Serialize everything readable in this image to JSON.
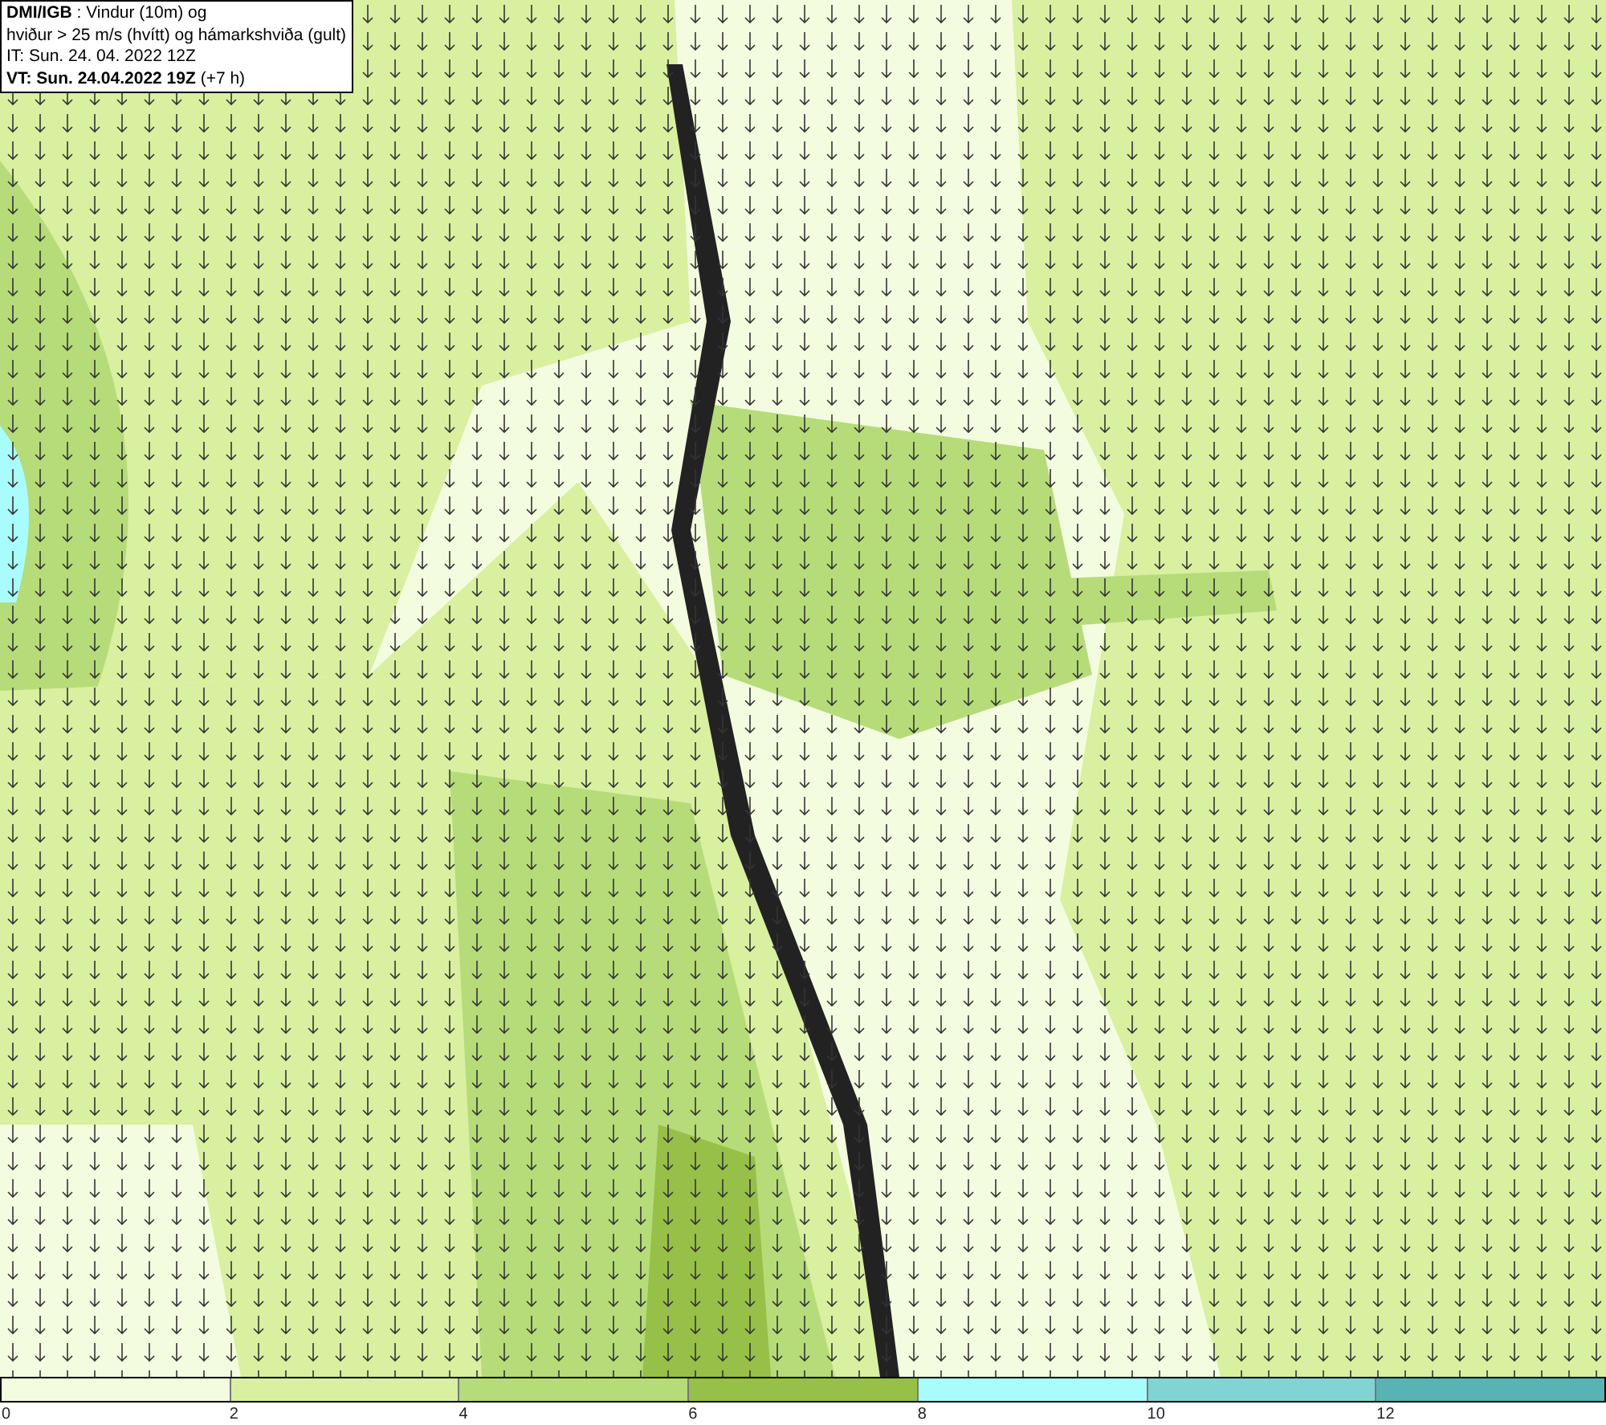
{
  "info_box": {
    "lines": [
      "**DMI/IGB** : Vindur (10m) og",
      "hviður > 25 m/s (hvítt) og hámarkshviða (gult)",
      "IT: Sun. 24. 04. 2022 12Z",
      "**VT: Sun. 24.04.2022 19Z** (+7 h)"
    ]
  },
  "legend": {
    "bins": [
      {
        "color": "#f4fce0"
      },
      {
        "color": "#d8f0a0"
      },
      {
        "color": "#b5dc78"
      },
      {
        "color": "#96c048"
      },
      {
        "color": "#a8fcfc"
      },
      {
        "color": "#80d4d4"
      },
      {
        "color": "#58b4b4"
      }
    ],
    "ticks": [
      "0",
      "2",
      "4",
      "6",
      "8",
      "10",
      "12"
    ]
  }
}
